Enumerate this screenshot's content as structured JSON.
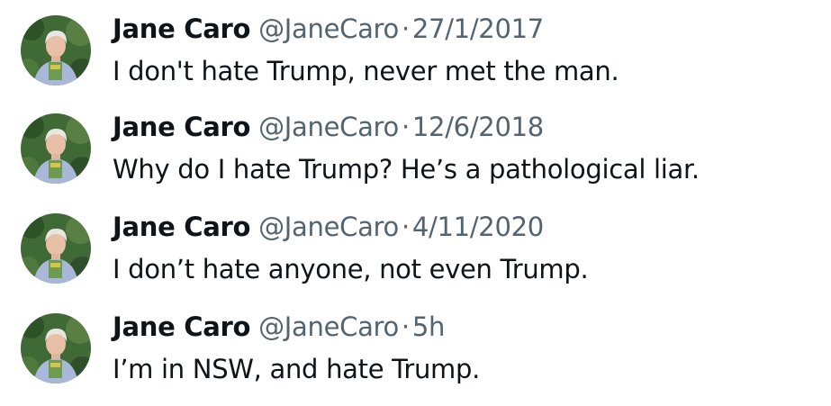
{
  "tweets": [
    {
      "name": "Jane Caro",
      "handle": "@JaneCaro",
      "separator": "·",
      "time": "27/1/2017",
      "text": "I don't hate Trump, never met the man."
    },
    {
      "name": "Jane Caro",
      "handle": "@JaneCaro",
      "separator": "·",
      "time": "12/6/2018",
      "text": "Why do I hate Trump? He’s a pathological liar."
    },
    {
      "name": "Jane Caro",
      "handle": "@JaneCaro",
      "separator": "·",
      "time": "4/11/2020",
      "text": "I don’t hate anyone, not even Trump."
    },
    {
      "name": "Jane Caro",
      "handle": "@JaneCaro",
      "separator": "·",
      "time": "5h",
      "text": "I’m in NSW, and hate Trump."
    }
  ],
  "colors": {
    "name": "#0f1419",
    "meta": "#536471",
    "text": "#0f1419",
    "background": "#ffffff"
  }
}
